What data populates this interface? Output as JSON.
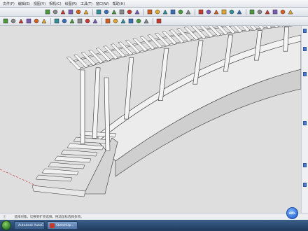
{
  "menubar": {
    "items": [
      "文件(F)",
      "编辑(E)",
      "视图(V)",
      "相机(C)",
      "绘图(R)",
      "工具(T)",
      "窗口(W)",
      "帮助(H)"
    ]
  },
  "toolbar1": {
    "icons": [
      "arrow-icon",
      "eraser-icon",
      "paint-bucket-icon",
      "hand-icon",
      "line-icon",
      "arc-icon",
      "rectangle-icon",
      "circle-icon",
      "polygon-icon",
      "freehand-icon",
      "push-pull-icon",
      "move-icon",
      "rotate-icon",
      "scale-icon",
      "offset-icon",
      "tape-icon",
      "text-icon",
      "axes-icon",
      "orbit-icon",
      "pan-icon",
      "zoom-icon",
      "zoom-extents-icon",
      "iso-view-icon",
      "top-view-icon",
      "front-view-icon",
      "right-view-icon",
      "back-view-icon",
      "left-view-icon",
      "xray-icon",
      "wireframe-icon",
      "hidden-line-icon",
      "shaded-icon",
      "textured-icon",
      "monochrome-icon"
    ]
  },
  "toolbar2": {
    "icons": [
      "select-icon",
      "component-icon",
      "paint-icon",
      "eraser-icon",
      "line-icon",
      "arc-icon",
      "shape-icon",
      "push-icon",
      "follow-me-icon",
      "offset-icon",
      "move-icon",
      "rotate-icon",
      "scale-icon",
      "tape-icon",
      "protractor-icon",
      "dimension-icon",
      "section-icon",
      "walk-icon",
      "look-icon"
    ]
  },
  "status": {
    "text": "选择对象。切换到扩充选择。拖动鼠标选择多项。"
  },
  "taskbar": {
    "buttons": [
      {
        "label": "Autodesk AutoC...",
        "color": "#c22b2b",
        "active": false
      },
      {
        "label": "SketchUp...",
        "color": "#c43a2a",
        "active": true
      }
    ],
    "tray_text": ""
  },
  "badge": {
    "text": "44%"
  },
  "colors": {
    "viewport_bg": "#dedede",
    "accent": "#2b6ad8"
  }
}
